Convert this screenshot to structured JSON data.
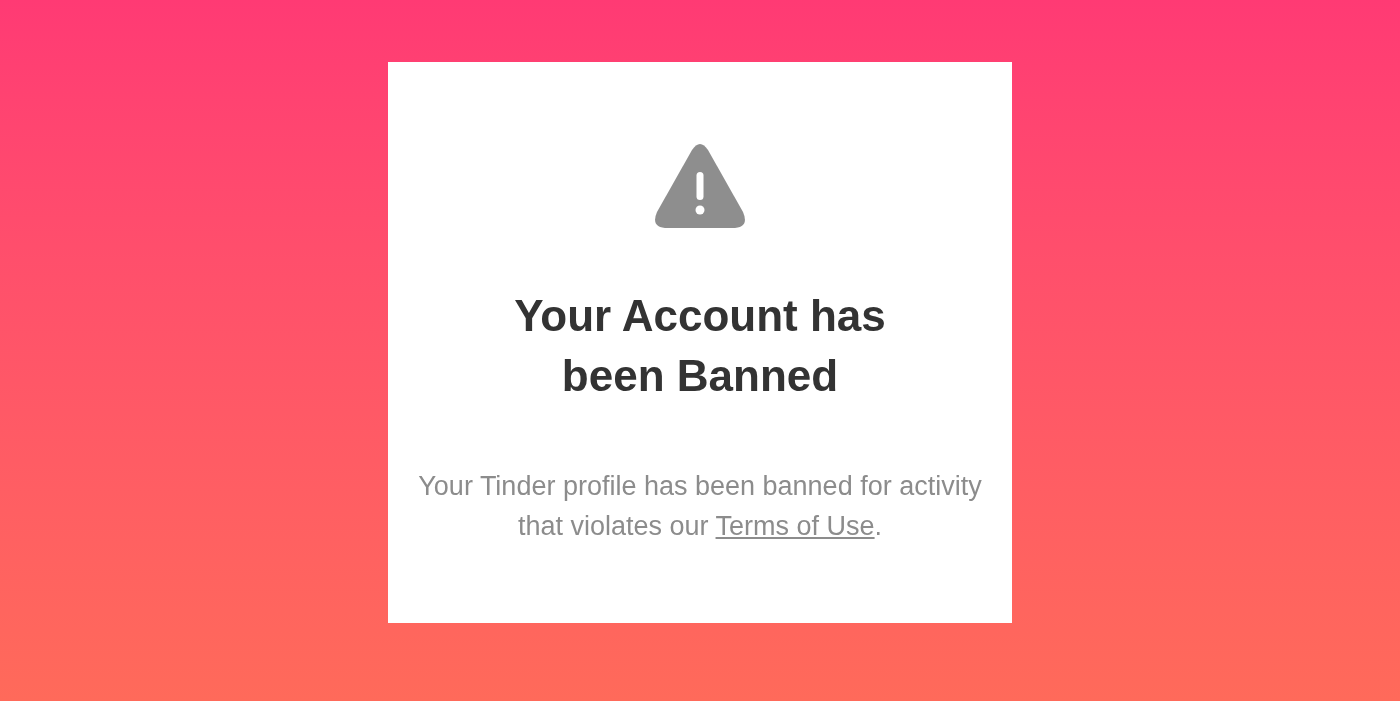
{
  "dialog": {
    "title": "Your Account has been Banned",
    "message": {
      "text": "Your Tinder profile has been banned for activity that violates our",
      "link": "Terms of Use",
      "end": "."
    }
  }
}
